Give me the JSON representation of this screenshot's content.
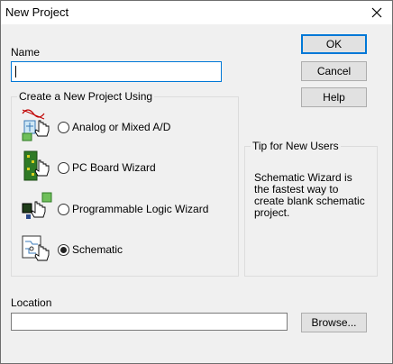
{
  "window": {
    "title": "New Project",
    "close_icon": "close-icon"
  },
  "name_field": {
    "label": "Name",
    "value": ""
  },
  "buttons": {
    "ok": "OK",
    "cancel": "Cancel",
    "help": "Help",
    "browse": "Browse..."
  },
  "project_group": {
    "legend": "Create a New Project Using",
    "options": [
      {
        "label": "Analog or Mixed A/D",
        "icon": "analog-mixed-icon",
        "selected": false
      },
      {
        "label": "PC Board Wizard",
        "icon": "pc-board-icon",
        "selected": false
      },
      {
        "label": "Programmable Logic Wizard",
        "icon": "programmable-logic-icon",
        "selected": false
      },
      {
        "label": "Schematic",
        "icon": "schematic-icon",
        "selected": true
      }
    ]
  },
  "tip": {
    "legend": "Tip for New Users",
    "text": "Schematic Wizard is the fastest way to create blank schematic project."
  },
  "location_field": {
    "label": "Location",
    "value": ""
  }
}
